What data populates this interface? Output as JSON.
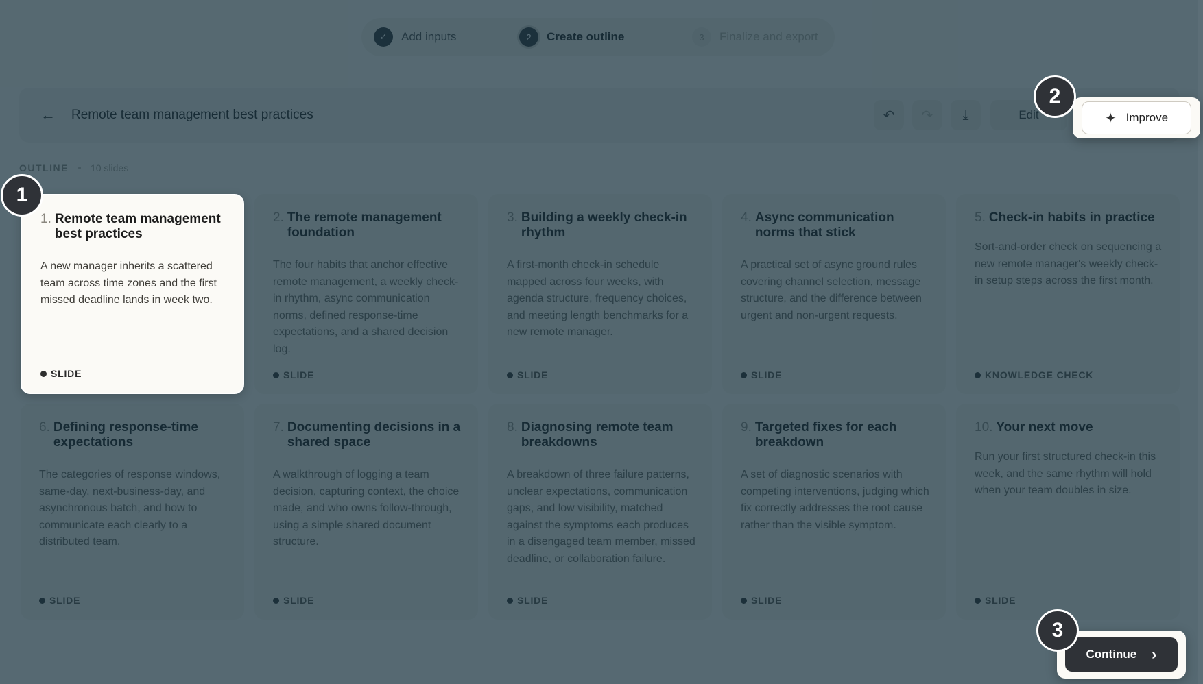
{
  "stepper": {
    "steps": [
      {
        "index": "✓",
        "label": "Add inputs",
        "state": "done"
      },
      {
        "index": "2",
        "label": "Create outline",
        "state": "current"
      },
      {
        "index": "3",
        "label": "Finalize and export",
        "state": "upcoming"
      }
    ]
  },
  "header": {
    "back_icon": "←",
    "title": "Remote team management best practices",
    "undo_icon": "↶",
    "redo_icon": "↷",
    "download_icon": "⤓",
    "edit_label": "Edit",
    "improve_label": "Improve",
    "improve_icon": "✦"
  },
  "outline": {
    "label": "OUTLINE",
    "count": "10 slides"
  },
  "cards": [
    {
      "num": "1.",
      "title": "Remote team management best practices",
      "desc": "A new manager inherits a scattered team across time zones and the first missed deadline lands in week two.",
      "tag": "SLIDE"
    },
    {
      "num": "2.",
      "title": "The remote management foundation",
      "desc": "The four habits that anchor effective remote management, a weekly check-in rhythm, async communication norms, defined response-time expectations, and a shared decision log.",
      "tag": "SLIDE"
    },
    {
      "num": "3.",
      "title": "Building a weekly check-in rhythm",
      "desc": "A first-month check-in schedule mapped across four weeks, with agenda structure, frequency choices, and meeting length benchmarks for a new remote manager.",
      "tag": "SLIDE"
    },
    {
      "num": "4.",
      "title": "Async communication norms that stick",
      "desc": "A practical set of async ground rules covering channel selection, message structure, and the difference between urgent and non-urgent requests.",
      "tag": "SLIDE"
    },
    {
      "num": "5.",
      "title": "Check-in habits in practice",
      "desc": "Sort-and-order check on sequencing a new remote manager's weekly check-in setup steps across the first month.",
      "tag": "KNOWLEDGE CHECK"
    },
    {
      "num": "6.",
      "title": "Defining response-time expectations",
      "desc": "The categories of response windows, same-day, next-business-day, and asynchronous batch, and how to communicate each clearly to a distributed team.",
      "tag": "SLIDE"
    },
    {
      "num": "7.",
      "title": "Documenting decisions in a shared space",
      "desc": "A walkthrough of logging a team decision, capturing context, the choice made, and who owns follow-through, using a simple shared document structure.",
      "tag": "SLIDE"
    },
    {
      "num": "8.",
      "title": "Diagnosing remote team breakdowns",
      "desc": "A breakdown of three failure patterns, unclear expectations, communication gaps, and low visibility, matched against the symptoms each produces in a disengaged team member, missed deadline, or collaboration failure.",
      "tag": "SLIDE"
    },
    {
      "num": "9.",
      "title": "Targeted fixes for each breakdown",
      "desc": "A set of diagnostic scenarios with competing interventions, judging which fix correctly addresses the root cause rather than the visible symptom.",
      "tag": "SLIDE"
    },
    {
      "num": "10.",
      "title": "Your next move",
      "desc": "Run your first structured check-in this week, and the same rhythm will hold when your team doubles in size.",
      "tag": "SLIDE"
    }
  ],
  "footer": {
    "continue_label": "Continue",
    "continue_icon": "›"
  },
  "callouts": [
    "1",
    "2",
    "3"
  ]
}
